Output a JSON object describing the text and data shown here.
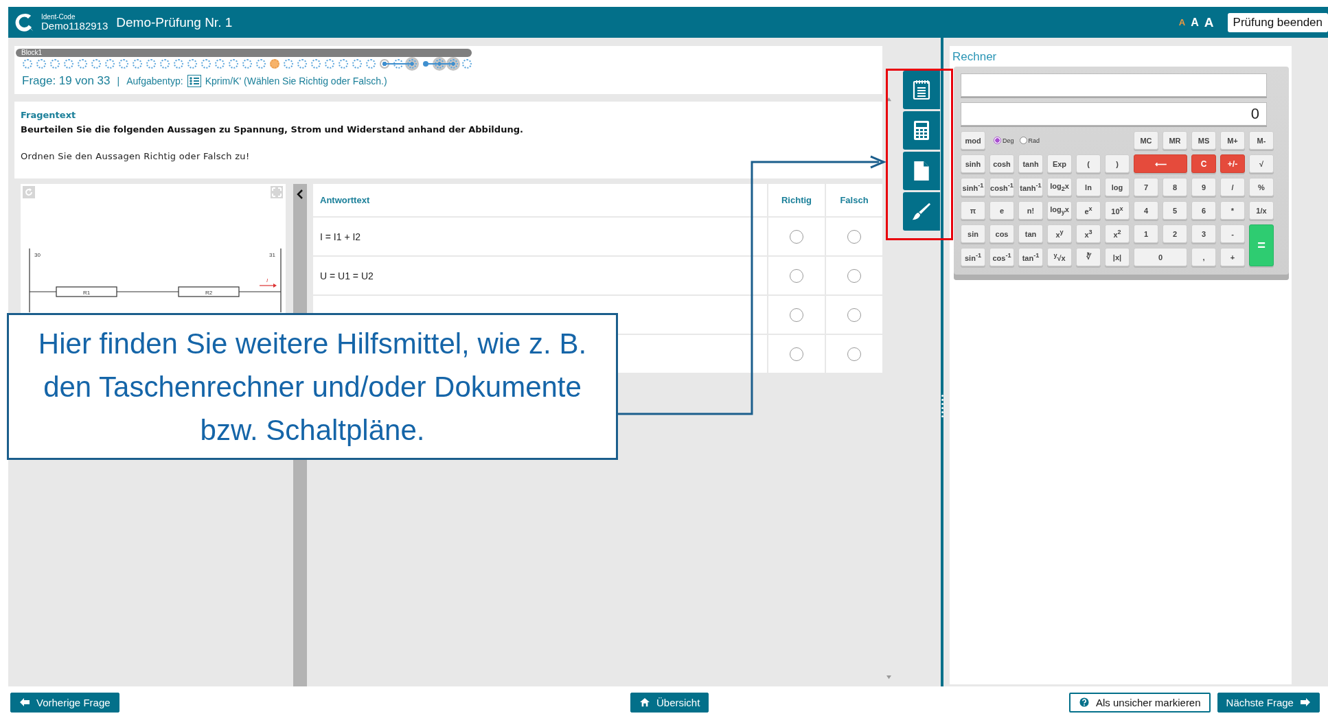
{
  "header": {
    "ident_label": "Ident-Code",
    "ident_code": "Demo1182913",
    "title": "Demo-Prüfung Nr. 1",
    "font_sizes": [
      {
        "label": "A",
        "selected": true
      },
      {
        "label": "A",
        "selected": false
      },
      {
        "label": "A",
        "selected": false
      }
    ],
    "end_button": "Prüfung beenden"
  },
  "progress": {
    "block": "Block1",
    "dots": [
      {
        "kind": "open",
        "selected": false,
        "linked": false
      },
      {
        "kind": "open",
        "selected": false,
        "linked": false
      },
      {
        "kind": "open",
        "selected": false,
        "linked": false
      },
      {
        "kind": "open",
        "selected": false,
        "linked": false
      },
      {
        "kind": "open",
        "selected": false,
        "linked": false
      },
      {
        "kind": "open",
        "selected": false,
        "linked": false
      },
      {
        "kind": "open",
        "selected": false,
        "linked": false
      },
      {
        "kind": "open",
        "selected": false,
        "linked": false
      },
      {
        "kind": "open",
        "selected": false,
        "linked": false
      },
      {
        "kind": "open",
        "selected": false,
        "linked": false
      },
      {
        "kind": "open",
        "selected": false,
        "linked": false
      },
      {
        "kind": "open",
        "selected": false,
        "linked": false
      },
      {
        "kind": "open",
        "selected": false,
        "linked": false
      },
      {
        "kind": "open",
        "selected": false,
        "linked": false
      },
      {
        "kind": "open",
        "selected": false,
        "linked": false
      },
      {
        "kind": "open",
        "selected": false,
        "linked": false
      },
      {
        "kind": "open",
        "selected": false,
        "linked": false
      },
      {
        "kind": "open",
        "selected": false,
        "linked": false
      },
      {
        "kind": "open",
        "selected": true,
        "linked": false
      },
      {
        "kind": "open",
        "selected": false,
        "linked": false
      },
      {
        "kind": "open",
        "selected": false,
        "linked": false
      },
      {
        "kind": "open",
        "selected": false,
        "linked": false
      },
      {
        "kind": "open",
        "selected": false,
        "linked": false
      },
      {
        "kind": "open",
        "selected": false,
        "linked": false
      },
      {
        "kind": "open",
        "selected": false,
        "linked": false
      },
      {
        "kind": "open",
        "selected": false,
        "linked": false
      },
      {
        "kind": "anchor",
        "selected": false,
        "linked": true
      },
      {
        "kind": "open",
        "selected": false,
        "linked": true
      },
      {
        "kind": "shaded",
        "selected": false,
        "linked": false
      },
      {
        "kind": "dot",
        "selected": false,
        "linked": true
      },
      {
        "kind": "shaded",
        "selected": false,
        "linked": true
      },
      {
        "kind": "shaded",
        "selected": false,
        "linked": false
      },
      {
        "kind": "open",
        "selected": false,
        "linked": false
      }
    ],
    "counter": "Frage: 19 von 33",
    "separator": "|",
    "task_type_label": "Aufgabentyp:",
    "task_type": "Kprim/K' (Wählen Sie Richtig oder Falsch.)"
  },
  "question": {
    "heading": "Fragentext",
    "prompt": "Beurteilen Sie die folgenden Aussagen zu Spannung, Strom und Widerstand anhand der Abbildung.",
    "instruction": "Ordnen Sie den Aussagen Richtig oder Falsch zu!"
  },
  "circuit": {
    "left_terminal": "30",
    "right_terminal": "31",
    "resistors": [
      "R1",
      "R2"
    ],
    "current": "I"
  },
  "answers": {
    "columns": [
      "Antworttext",
      "Richtig",
      "Falsch"
    ],
    "rows": [
      {
        "text": "I = I1 + I2",
        "right": false,
        "wrong": false
      },
      {
        "text": "U = U1 = U2",
        "right": false,
        "wrong": false
      },
      {
        "right": false,
        "wrong": false
      },
      {
        "right": false,
        "wrong": false
      }
    ]
  },
  "tools": [
    {
      "kind": "notes"
    },
    {
      "kind": "calculator"
    },
    {
      "kind": "document"
    },
    {
      "kind": "brush"
    }
  ],
  "calculator": {
    "title": "Rechner",
    "display": "0",
    "keys": [
      {
        "kind": "key",
        "label": "mod"
      },
      {
        "kind": "modes",
        "options": [
          {
            "label": "Deg",
            "selected": true
          },
          {
            "label": "Rad",
            "selected": false
          }
        ]
      },
      {
        "kind": "key",
        "label": "MC"
      },
      {
        "kind": "key",
        "label": "MR"
      },
      {
        "kind": "key",
        "label": "MS"
      },
      {
        "kind": "key",
        "label": "M+"
      },
      {
        "kind": "key",
        "label": "M-"
      },
      {
        "kind": "key",
        "label": "sinh"
      },
      {
        "kind": "key",
        "label": "cosh"
      },
      {
        "kind": "key",
        "label": "tanh"
      },
      {
        "kind": "key",
        "label": "Exp"
      },
      {
        "kind": "key",
        "label": "("
      },
      {
        "kind": "key",
        "label": ")"
      },
      {
        "kind": "danger-wide",
        "label": "⟵"
      },
      {
        "kind": "danger",
        "label": "C"
      },
      {
        "kind": "danger",
        "label": "+/-"
      },
      {
        "kind": "key",
        "label": "√"
      },
      {
        "kind": "key",
        "label": "sinh$^{-1}$"
      },
      {
        "kind": "key",
        "label": "cosh$^{-1}$"
      },
      {
        "kind": "key",
        "label": "tanh$^{-1}$"
      },
      {
        "kind": "key",
        "label": "log$_{2}$x"
      },
      {
        "kind": "key",
        "label": "ln"
      },
      {
        "kind": "key",
        "label": "log"
      },
      {
        "kind": "key",
        "label": "7"
      },
      {
        "kind": "key",
        "label": "8"
      },
      {
        "kind": "key",
        "label": "9"
      },
      {
        "kind": "key",
        "label": "/"
      },
      {
        "kind": "key",
        "label": "%"
      },
      {
        "kind": "key",
        "label": "π"
      },
      {
        "kind": "key",
        "label": "e"
      },
      {
        "kind": "key",
        "label": "n!"
      },
      {
        "kind": "key",
        "label": "log$_{y}$x"
      },
      {
        "kind": "key",
        "label": "e$^{x}$"
      },
      {
        "kind": "key",
        "label": "10$^{x}$"
      },
      {
        "kind": "key",
        "label": "4"
      },
      {
        "kind": "key",
        "label": "5"
      },
      {
        "kind": "key",
        "label": "6"
      },
      {
        "kind": "key",
        "label": "*"
      },
      {
        "kind": "key",
        "label": "1/x"
      },
      {
        "kind": "key",
        "label": "sin"
      },
      {
        "kind": "key",
        "label": "cos"
      },
      {
        "kind": "key",
        "label": "tan"
      },
      {
        "kind": "key",
        "label": "x$^{y}$"
      },
      {
        "kind": "key",
        "label": "x$^{3}$"
      },
      {
        "kind": "key",
        "label": "x$^{2}$"
      },
      {
        "kind": "key",
        "label": "1"
      },
      {
        "kind": "key",
        "label": "2"
      },
      {
        "kind": "key",
        "label": "3"
      },
      {
        "kind": "key",
        "label": "-"
      },
      {
        "kind": "equals",
        "label": "="
      },
      {
        "kind": "key",
        "label": "sin$^{-1}$"
      },
      {
        "kind": "key",
        "label": "cos$^{-1}$"
      },
      {
        "kind": "key",
        "label": "tan$^{-1}$"
      },
      {
        "kind": "key",
        "label": "$^{y}$√x"
      },
      {
        "kind": "key",
        "label": "∛"
      },
      {
        "kind": "key",
        "label": "|x|"
      },
      {
        "kind": "wide",
        "label": "0"
      },
      {
        "kind": "key",
        "label": ","
      },
      {
        "kind": "key",
        "label": "+"
      }
    ]
  },
  "footer": [
    {
      "kind": "prev",
      "label": "Vorherige Frage"
    },
    {
      "kind": "home",
      "label": "Übersicht"
    },
    {
      "kind": "flag",
      "label": "Als unsicher markieren"
    },
    {
      "kind": "next",
      "label": "Nächste Frage"
    }
  ],
  "callout": {
    "text": "Hier finden Sie weitere Hilfsmittel, wie z. B. den Taschenrechner und/oder Dokumente bzw. Schaltpläne."
  }
}
